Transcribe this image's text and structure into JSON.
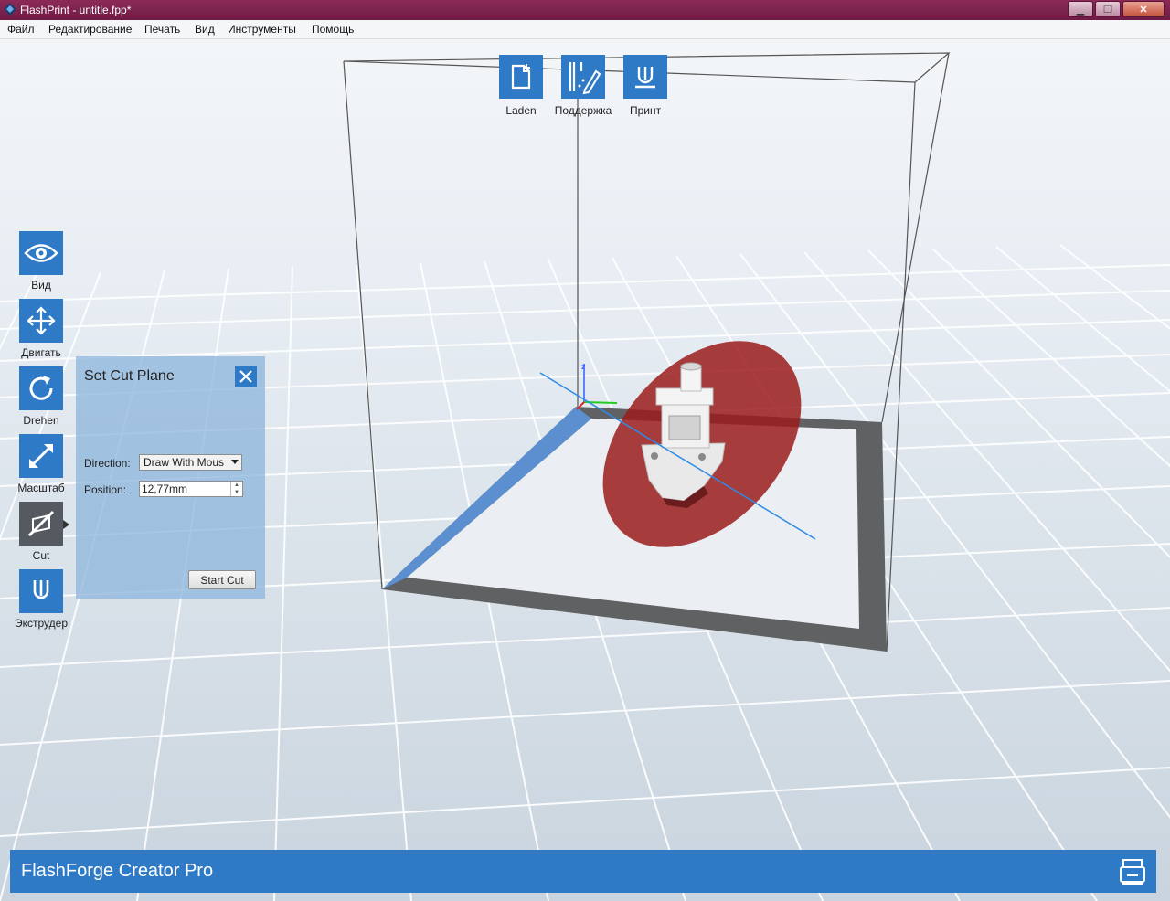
{
  "window": {
    "title": "FlashPrint - untitle.fpp*"
  },
  "menu": {
    "items": [
      "Файл",
      "Редактирование",
      "Печать",
      "Вид",
      "Инструменты",
      "Помощь"
    ]
  },
  "top_toolbar": [
    {
      "label": "Laden",
      "icon": "load-file-icon"
    },
    {
      "label": "Поддержка",
      "icon": "support-icon"
    },
    {
      "label": "Принт",
      "icon": "print-icon"
    }
  ],
  "left_toolbar": [
    {
      "label": "Вид",
      "icon": "eye-icon"
    },
    {
      "label": "Двигать",
      "icon": "move-icon"
    },
    {
      "label": "Drehen",
      "icon": "rotate-icon"
    },
    {
      "label": "Масштаб",
      "icon": "scale-icon"
    },
    {
      "label": "Cut",
      "icon": "cut-icon",
      "active": true
    },
    {
      "label": "Экструдер",
      "icon": "extruder-icon"
    }
  ],
  "cut_panel": {
    "title": "Set Cut Plane",
    "direction_label": "Direction:",
    "direction_value": "Draw With Mous",
    "position_label": "Position:",
    "position_value": "12,77mm",
    "start_cut_label": "Start Cut"
  },
  "status": {
    "printer_name": "FlashForge Creator Pro"
  },
  "colors": {
    "accent": "#2f7ac6",
    "titlebar": "#7a1f4b",
    "cut_plane": "#9b1c1c"
  }
}
